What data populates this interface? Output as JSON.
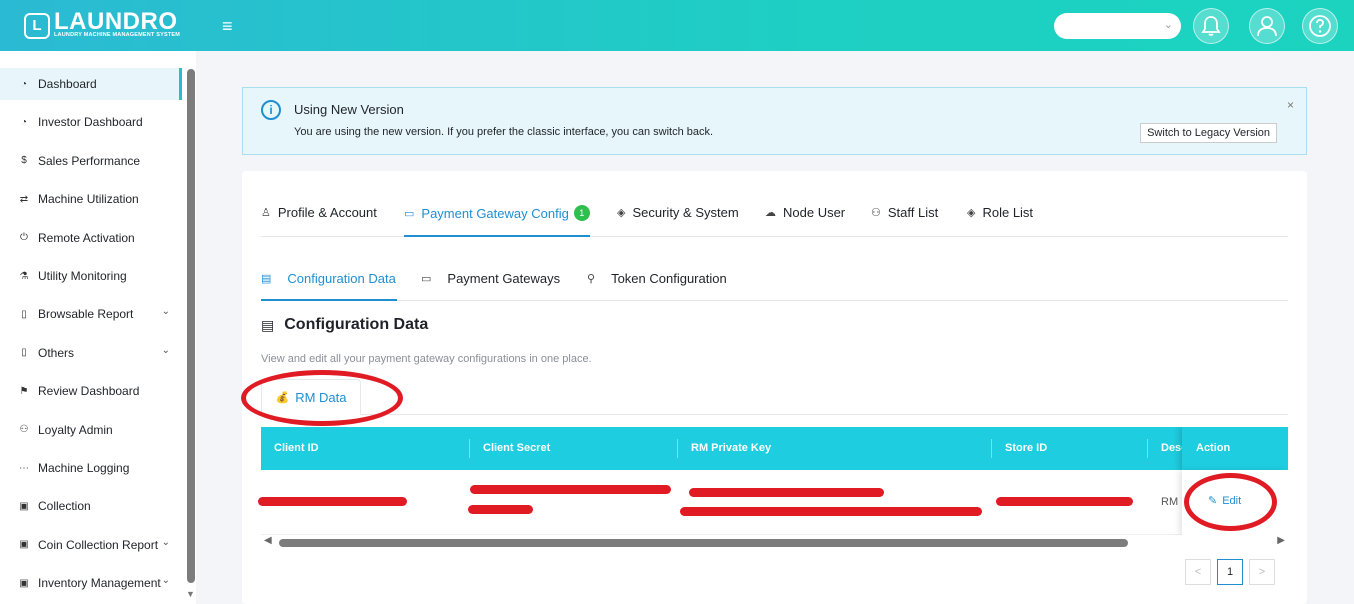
{
  "brand": {
    "logo_letter": "L",
    "name": "LAUNDRO",
    "tagline": "LAUNDRY MACHINE MANAGEMENT SYSTEM"
  },
  "header": {
    "menu_glyph": "≡"
  },
  "sidebar": {
    "items": [
      {
        "label": "Dashboard",
        "icon": "dashboard-icon",
        "glyph": "◔",
        "active": true
      },
      {
        "label": "Investor Dashboard",
        "icon": "dashboard-icon",
        "glyph": "◔"
      },
      {
        "label": "Sales Performance",
        "icon": "dollar-icon",
        "glyph": "$"
      },
      {
        "label": "Machine Utilization",
        "icon": "swap-icon",
        "glyph": "⇄"
      },
      {
        "label": "Remote Activation",
        "icon": "power-icon",
        "glyph": "⏻"
      },
      {
        "label": "Utility Monitoring",
        "icon": "flask-icon",
        "glyph": "⚗"
      },
      {
        "label": "Browsable Report",
        "icon": "file-icon",
        "glyph": "▯",
        "caret": "⌄"
      },
      {
        "label": "Others",
        "icon": "copy-icon",
        "glyph": "▯",
        "caret": "⌄"
      },
      {
        "label": "Review Dashboard",
        "icon": "flag-icon",
        "glyph": "⚑"
      },
      {
        "label": "Loyalty Admin",
        "icon": "users-icon",
        "glyph": "⚇"
      },
      {
        "label": "Machine Logging",
        "icon": "dots-icon",
        "glyph": "⋯"
      },
      {
        "label": "Collection",
        "icon": "collection-icon",
        "glyph": "▣"
      },
      {
        "label": "Coin Collection Report",
        "icon": "report-icon",
        "glyph": "▣",
        "caret": "⌄"
      },
      {
        "label": "Inventory Management",
        "icon": "inventory-icon",
        "glyph": "▣",
        "caret": "⌄"
      }
    ]
  },
  "alert": {
    "title": "Using New Version",
    "description": "You are using the new version. If you prefer the classic interface, you can switch back.",
    "button": "Switch to Legacy Version",
    "close": "×"
  },
  "tabs": [
    {
      "label": "Profile & Account",
      "glyph": "♙"
    },
    {
      "label": "Payment Gateway Config",
      "glyph": "▭",
      "badge": "1",
      "active": true
    },
    {
      "label": "Security & System",
      "glyph": "◈"
    },
    {
      "label": "Node User",
      "glyph": "☁"
    },
    {
      "label": "Staff List",
      "glyph": "⚇"
    },
    {
      "label": "Role List",
      "glyph": "◈"
    }
  ],
  "subtabs": [
    {
      "label": "Configuration Data",
      "glyph": "▤",
      "active": true
    },
    {
      "label": "Payment Gateways",
      "glyph": "▭"
    },
    {
      "label": "Token Configuration",
      "glyph": "⚲"
    }
  ],
  "section": {
    "title": "Configuration Data",
    "glyph": "▤",
    "description": "View and edit all your payment gateway configurations in one place."
  },
  "rm_tab": {
    "emoji": "💰",
    "label": "RM Data"
  },
  "table": {
    "columns": [
      "Client ID",
      "Client Secret",
      "RM Private Key",
      "Store ID",
      "Desc",
      "Action"
    ],
    "row": {
      "desc": "RM",
      "action": "Edit"
    }
  },
  "pagination": {
    "prev": "<",
    "current": "1",
    "next": ">"
  },
  "colors": {
    "brand": "#2bbad3",
    "primary": "#1f8fd1",
    "table_header": "#1ecde0",
    "annotation": "#e01b24",
    "badge": "#2fbf4f"
  }
}
